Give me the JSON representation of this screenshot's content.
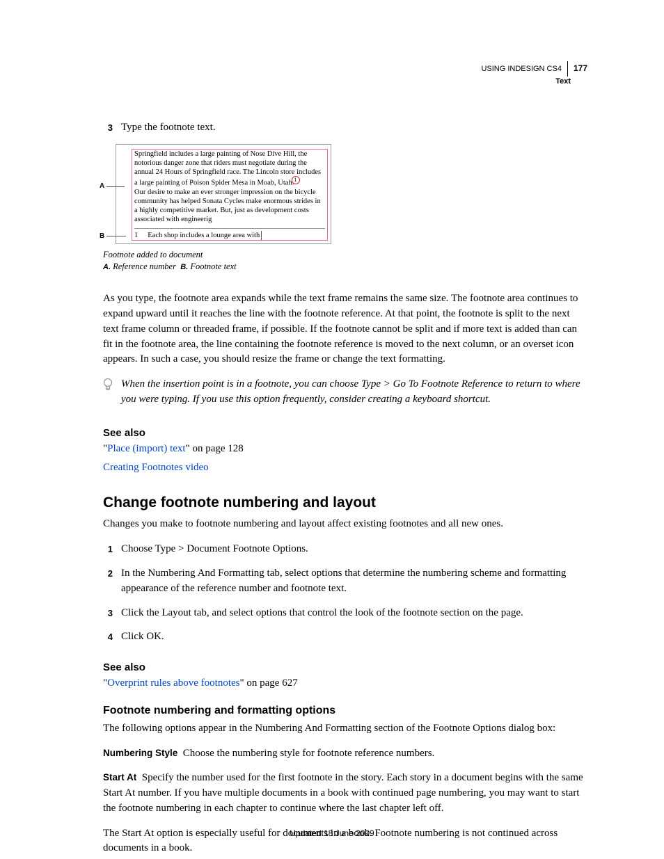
{
  "header": {
    "product": "USING INDESIGN CS4",
    "section": "Text",
    "page_number": "177"
  },
  "step3": {
    "num": "3",
    "text": "Type the footnote text."
  },
  "figure": {
    "para": "Springfield includes a large painting of Nose Dive Hill, the notorious danger zone that riders must negotiate during the annual 24 Hours of Springfield race. The Lincoln store includes a large painting of Poison Spider Mesa in Moab, Utah.",
    "para2": "Our desire to make an ever stronger impression on the bicycle community has helped Sonata Cycles make enormous strides in a highly competitive market. But, just as development costs associated with engineerig",
    "fn_num": "1",
    "fn_text": "Each shop includes a lounge area with",
    "label_a": "A",
    "label_b": "B",
    "sup": "1"
  },
  "caption": "Footnote added to document",
  "callout": {
    "a_key": "A.",
    "a_text": "Reference number",
    "b_key": "B.",
    "b_text": "Footnote text"
  },
  "para_expand": "As you type, the footnote area expands while the text frame remains the same size. The footnote area continues to expand upward until it reaches the line with the footnote reference. At that point, the footnote is split to the next text frame column or threaded frame, if possible. If the footnote cannot be split and if more text is added than can fit in the footnote area, the line containing the footnote reference is moved to the next column, or an overset icon appears. In such a case, you should resize the frame or change the text formatting.",
  "tip": "When the insertion point is in a footnote, you can choose Type > Go To Footnote Reference to return to where you were typing. If you use this option frequently, consider creating a keyboard shortcut.",
  "seealso1": {
    "heading": "See also",
    "link1_text": "Place (import) text",
    "link1_suffix": "\" on page 128",
    "link1_prefix": "\"",
    "link2": "Creating Footnotes video"
  },
  "h2_change": "Change footnote numbering and layout",
  "para_change": "Changes you make to footnote numbering and layout affect existing footnotes and all new ones.",
  "steps_change": [
    {
      "num": "1",
      "text": "Choose Type > Document Footnote Options."
    },
    {
      "num": "2",
      "text": "In the Numbering And Formatting tab, select options that determine the numbering scheme and formatting appearance of the reference number and footnote text."
    },
    {
      "num": "3",
      "text": "Click the Layout tab, and select options that control the look of the footnote section on the page."
    },
    {
      "num": "4",
      "text": "Click OK."
    }
  ],
  "seealso2": {
    "heading": "See also",
    "link_prefix": "\"",
    "link_text": "Overprint rules above footnotes",
    "link_suffix": "\" on page 627"
  },
  "h3_options": "Footnote numbering and formatting options",
  "para_options": "The following options appear in the Numbering And Formatting section of the Footnote Options dialog box:",
  "opt_numstyle": {
    "label": "Numbering Style",
    "text": "Choose the numbering style for footnote reference numbers."
  },
  "opt_startat": {
    "label": "Start At",
    "text": "Specify the number used for the first footnote in the story. Each story in a document begins with the same Start At number. If you have multiple documents in a book with continued page numbering, you may want to start the footnote numbering in each chapter to continue where the last chapter left off."
  },
  "para_startat2": "The Start At option is especially useful for documents in a book. Footnote numbering is not continued across documents in a book.",
  "footer": "Updated 18 June 2009"
}
